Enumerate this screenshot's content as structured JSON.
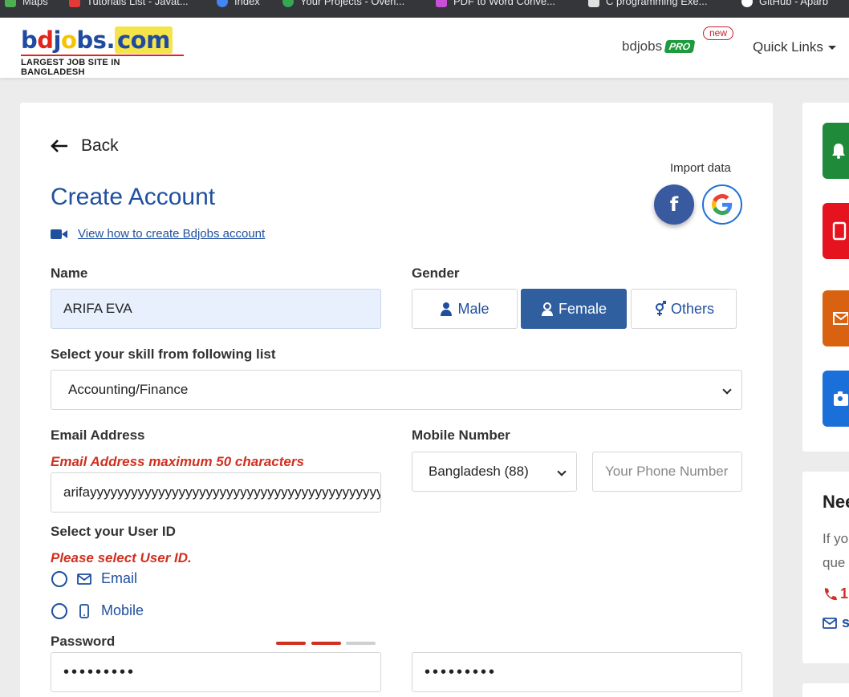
{
  "bookmarks": [
    {
      "label": "Maps",
      "color": "#4caf50"
    },
    {
      "label": "Tutorials List - Javat...",
      "color": "#e53935"
    },
    {
      "label": "Index",
      "color": "#4285f4"
    },
    {
      "label": "Your Projects - Overl...",
      "color": "#34a853"
    },
    {
      "label": "PDF to Word Conve...",
      "color": "#c94fd6"
    },
    {
      "label": "C programming Exe...",
      "color": "#e0e0e0"
    },
    {
      "label": "GitHub - Aparb",
      "color": "#ffffff"
    }
  ],
  "header": {
    "logo_tagline": "LARGEST JOB SITE IN BANGLADESH",
    "pro_text": "bdjobs",
    "pro_badge": "PRO",
    "new_badge": "new",
    "quick_links": "Quick Links"
  },
  "form": {
    "back_label": "Back",
    "title": "Create Account",
    "howto_link": "View how to create Bdjobs account",
    "import_label": "Import data",
    "facebook_glyph": "f",
    "name_label": "Name",
    "name_value": "ARIFA EVA",
    "gender_label": "Gender",
    "gender_options": {
      "male": "Male",
      "female": "Female",
      "others": "Others"
    },
    "gender_selected": "Female",
    "skill_label": "Select your skill from following list",
    "skill_value": "Accounting/Finance",
    "email_label": "Email Address",
    "email_error": "Email Address maximum 50 characters",
    "email_value": "arifayyyyyyyyyyyyyyyyyyyyyyyyyyyyyyyyyyyyyyyyyyyy",
    "mobile_label": "Mobile Number",
    "country_value": "Bangladesh (88)",
    "phone_placeholder": "Your Phone Number",
    "userid_label": "Select your User ID",
    "userid_error": "Please select User ID.",
    "userid_options": {
      "email": "Email",
      "mobile": "Mobile"
    },
    "password_label": "Password",
    "password_value": "•••••••••",
    "confirm_value": "•••••••••",
    "password_strength_segments": 2,
    "password_strength_total": 3
  },
  "sidebar": {
    "icons": [
      {
        "name": "bell-icon",
        "color": "#1e8a3a"
      },
      {
        "name": "mobile-icon",
        "color": "#e5131d"
      },
      {
        "name": "mail-icon",
        "color": "#d8620f"
      },
      {
        "name": "id-card-icon",
        "color": "#1a6fd8"
      }
    ],
    "help_title": "Nee",
    "help_line1": "If yo",
    "help_line2": "que",
    "help_phone": "1",
    "help_email": "s"
  },
  "colors": {
    "brand_blue": "#1f4f9e",
    "error_red": "#d1301f",
    "active_gender": "#2f5f9e"
  }
}
